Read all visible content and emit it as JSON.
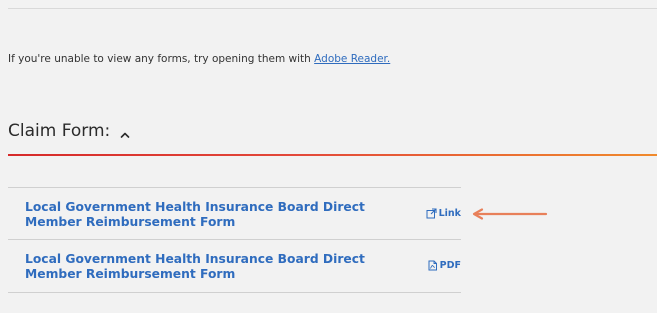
{
  "notice": {
    "prefix": "If you're unable to view any forms, try opening them with ",
    "link_text": "Adobe Reader."
  },
  "section": {
    "title": "Claim Form:",
    "toggle_icon": "chevron-up-icon"
  },
  "forms": [
    {
      "title": "Local Government Health Insurance Board Direct Member Reimbursement Form",
      "action_label": "Link",
      "action_icon": "external-link-icon"
    },
    {
      "title": "Local Government Health Insurance Board Direct Member Reimbursement Form",
      "action_label": "PDF",
      "action_icon": "pdf-file-icon"
    }
  ],
  "colors": {
    "link_blue": "#2f6cbe",
    "accent_red": "#d62a2a",
    "accent_orange": "#f08a2c",
    "annotation_arrow": "#e8805a"
  }
}
